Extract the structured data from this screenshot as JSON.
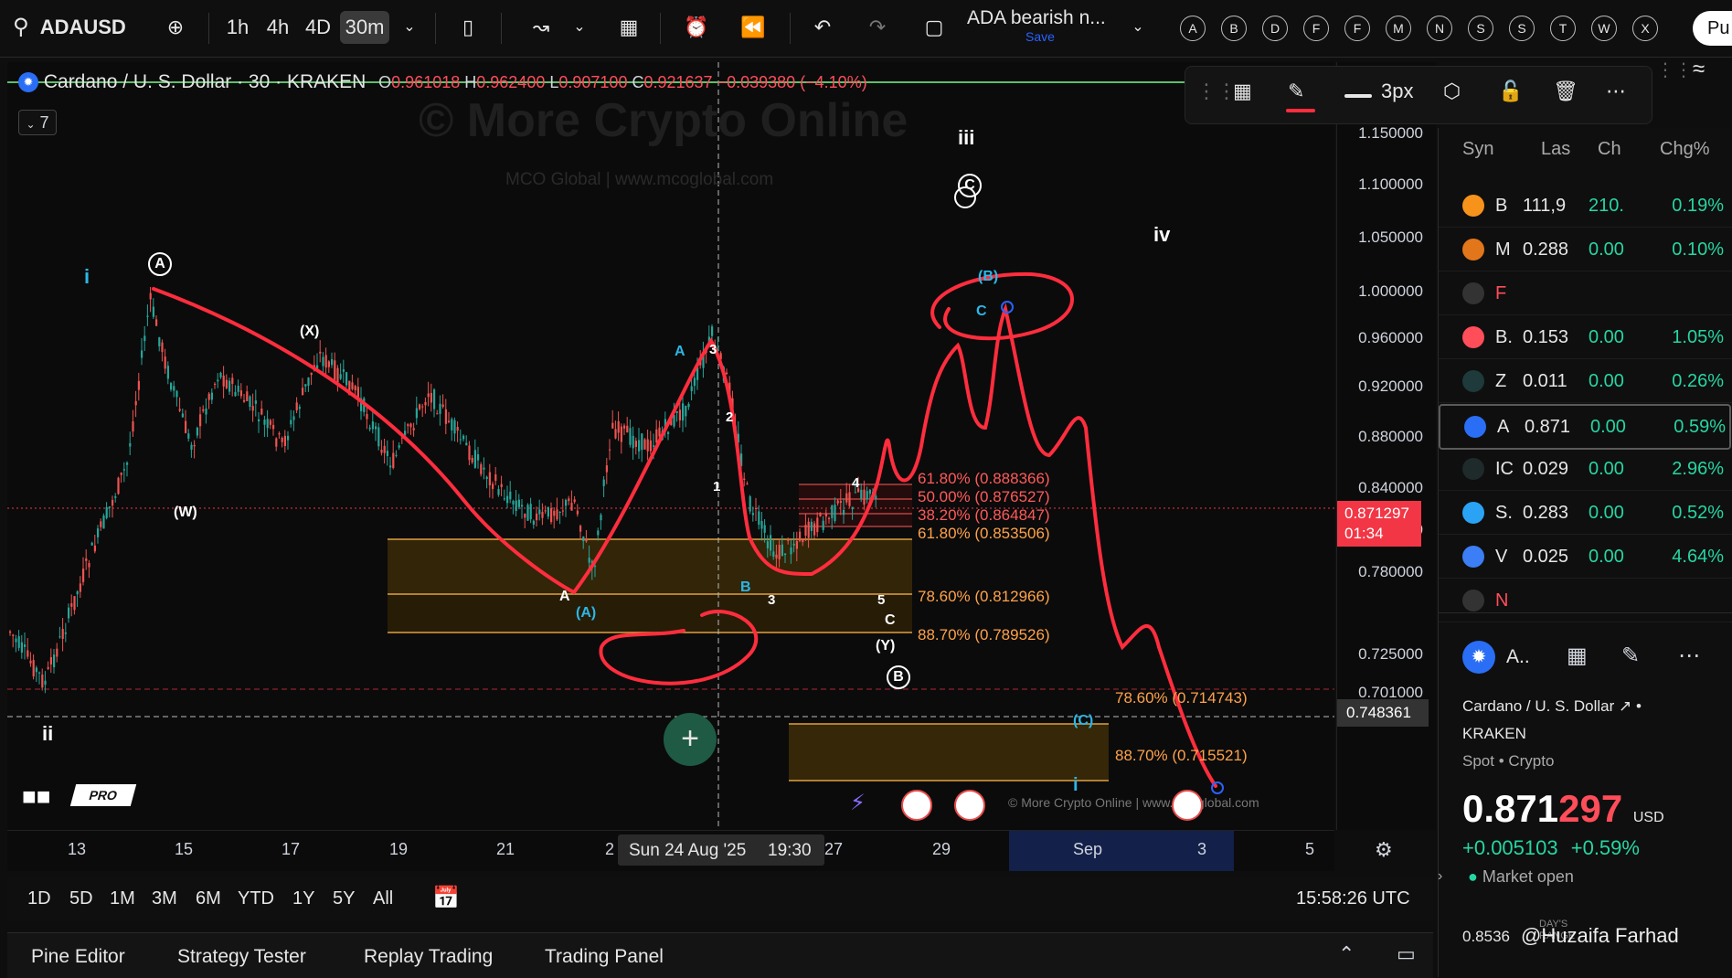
{
  "toolbar": {
    "symbol": "ADAUSD",
    "intervals": [
      "1h",
      "4h",
      "4D",
      "30m"
    ],
    "active_interval": "30m",
    "layout_name": "ADA bearish n...",
    "layout_save": "Save",
    "alert_letters": [
      "A",
      "B",
      "D",
      "F",
      "F",
      "M",
      "N",
      "S",
      "S",
      "T",
      "W",
      "X"
    ],
    "publish_label": "Pu"
  },
  "legend": {
    "title": "Cardano / U. S. Dollar · 30 · KRAKEN",
    "o_label": "O",
    "o": "0.961018",
    "h_label": "H",
    "h": "0.962400",
    "l_label": "L",
    "l": "0.907100",
    "c_label": "C",
    "c": "0.921637",
    "change": "−0.039380 (−4.10%)",
    "indicator_count": "7"
  },
  "watermark": {
    "main": "© More Crypto Online",
    "sub": "MCO Global  |  www.mcoglobal.com",
    "footer": "© More Crypto Online  |  www.mcoglobal.com"
  },
  "drawing_toolbar": {
    "width_label": "3px"
  },
  "price_axis": {
    "labels": [
      "1.150000",
      "1.100000",
      "1.050000",
      "1.000000",
      "0.960000",
      "0.920000",
      "0.880000",
      "0.840000",
      "0.810000",
      "0.780000",
      "0.725000",
      "0.701000"
    ],
    "current_price": "0.871297",
    "countdown": "01:34",
    "crosshair_price": "0.748361"
  },
  "time_axis": {
    "labels": [
      "13",
      "15",
      "17",
      "19",
      "21",
      "2",
      "27",
      "29",
      "Sep",
      "3",
      "5"
    ],
    "crosshair_date": "Sun 24 Aug '25",
    "crosshair_time": "19:30"
  },
  "fib_levels": [
    {
      "text": "61.80% (0.888366)",
      "color": "#ff5a5a"
    },
    {
      "text": "50.00% (0.876527)",
      "color": "#ff5a5a"
    },
    {
      "text": "38.20% (0.864847)",
      "color": "#ff5a5a"
    },
    {
      "text": "61.80% (0.853506)",
      "color": "#ffa24a"
    },
    {
      "text": "78.60% (0.812966)",
      "color": "#ffa24a"
    },
    {
      "text": "88.70% (0.789526)",
      "color": "#ffa24a"
    },
    {
      "text": "78.60% (0.714743)",
      "color": "#ffa24a"
    },
    {
      "text": "88.70% (0.715521)",
      "color": "#ffa24a"
    }
  ],
  "wave_labels": [
    "i",
    "ii",
    "iii",
    "iv",
    "A",
    "C",
    "B",
    "(X)",
    "(W)",
    "(A)",
    "(B)",
    "(Y)",
    "(C)",
    "1",
    "2",
    "3",
    "4",
    "5"
  ],
  "range_bar": {
    "ranges": [
      "1D",
      "5D",
      "1M",
      "3M",
      "6M",
      "YTD",
      "1Y",
      "5Y",
      "All"
    ],
    "clock": "15:58:26 UTC"
  },
  "bottom_tabs": [
    "Pine Editor",
    "Strategy Tester",
    "Replay Trading",
    "Trading Panel"
  ],
  "watchlist": {
    "headers": [
      "Syn",
      "Las",
      "Ch",
      "Chg%"
    ],
    "rows": [
      {
        "sym": "B",
        "last": "111,9",
        "chg": "210.",
        "pct": "0.19%",
        "icon_color": "#f7931a",
        "pct_color": "#26d6a2"
      },
      {
        "sym": "M",
        "last": "0.288",
        "chg": "0.00",
        "pct": "0.10%",
        "icon_color": "#e2761b",
        "pct_color": "#26d6a2"
      },
      {
        "sym": "F",
        "last": "",
        "chg": "",
        "pct": "",
        "icon_color": "#333333",
        "pct_color": "#ff4d5a"
      },
      {
        "sym": "B.",
        "last": "0.153",
        "chg": "0.00",
        "pct": "1.05%",
        "icon_color": "#ff4d5a",
        "pct_color": "#26d6a2"
      },
      {
        "sym": "Z",
        "last": "0.011",
        "chg": "0.00",
        "pct": "0.26%",
        "icon_color": "#1e3a3a",
        "pct_color": "#26d6a2"
      },
      {
        "sym": "A",
        "last": "0.871",
        "chg": "0.00",
        "pct": "0.59%",
        "icon_color": "#2a6ef5",
        "pct_color": "#26d6a2"
      },
      {
        "sym": "IC",
        "last": "0.029",
        "chg": "0.00",
        "pct": "2.96%",
        "icon_color": "#1f2a2a",
        "pct_color": "#26d6a2"
      },
      {
        "sym": "S.",
        "last": "0.283",
        "chg": "0.00",
        "pct": "0.52%",
        "icon_color": "#2aa3f5",
        "pct_color": "#26d6a2"
      },
      {
        "sym": "V",
        "last": "0.025",
        "chg": "0.00",
        "pct": "4.64%",
        "icon_color": "#3b7ef5",
        "pct_color": "#26d6a2"
      },
      {
        "sym": "N",
        "last": "",
        "chg": "",
        "pct": "",
        "icon_color": "#333333",
        "pct_color": "#ff4d5a"
      }
    ]
  },
  "details": {
    "symbol_short": "A..",
    "name": "Cardano / U. S. Dollar",
    "exchange": "KRAKEN",
    "category": "Spot • Crypto",
    "price_main": "0.871",
    "price_tail": "297",
    "currency": "USD",
    "change": "+0.005103",
    "change_pct": "+0.59%",
    "market_status": "Market open",
    "days_low": "0.8536",
    "days_range_label": "DAY'S RANGE",
    "watermark_user": "@Huzaifa Farhad"
  },
  "colors": {
    "red_draw": "#ff2d3d",
    "up": "#26a69a",
    "down": "#ef5350",
    "fib_zone": "#3a2a08",
    "accent": "#2962ff"
  }
}
